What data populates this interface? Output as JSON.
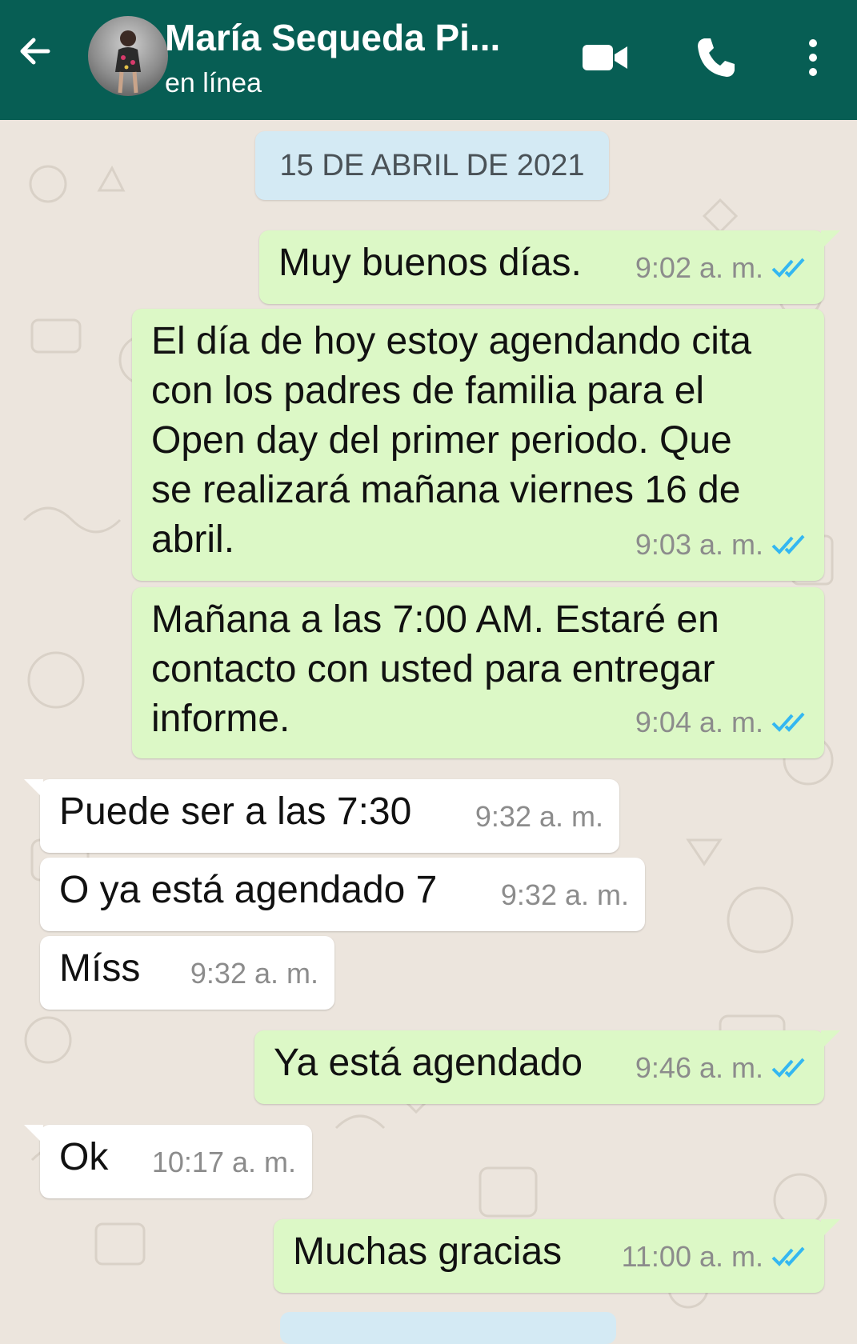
{
  "header": {
    "contact_name": "María Sequeda Pi...",
    "status": "en línea"
  },
  "date_chip": "15 DE ABRIL DE 2021",
  "messages": [
    {
      "direction": "out",
      "text": "Muy buenos días.",
      "time": "9:02 a. m.",
      "read": true
    },
    {
      "direction": "out",
      "text": "El día de hoy estoy agendando cita\ncon los padres de familia para el\nOpen day del primer periodo. Que\nse realizará mañana viernes 16 de\nabril.",
      "time": "9:03 a. m.",
      "read": true
    },
    {
      "direction": "out",
      "text": "Mañana a las 7:00 AM. Estaré en\ncontacto con usted para entregar\ninforme.",
      "time": "9:04 a. m.",
      "read": true
    },
    {
      "direction": "in",
      "text": "Puede ser a las 7:30",
      "time": "9:32 a. m."
    },
    {
      "direction": "in",
      "text": "O ya está agendado 7",
      "time": "9:32 a. m."
    },
    {
      "direction": "in",
      "text": "Míss",
      "time": "9:32 a. m."
    },
    {
      "direction": "out",
      "text": "Ya está agendado",
      "time": "9:46 a. m.",
      "read": true
    },
    {
      "direction": "in",
      "text": "Ok",
      "time": "10:17 a. m."
    },
    {
      "direction": "out",
      "text": "Muchas gracias",
      "time": "11:00 a. m.",
      "read": true
    }
  ],
  "colors": {
    "header": "#075e54",
    "outgoing_bubble": "#dcf8c6",
    "incoming_bubble": "#ffffff",
    "read_ticks": "#34b7f1",
    "chat_background": "#ece5dd"
  }
}
